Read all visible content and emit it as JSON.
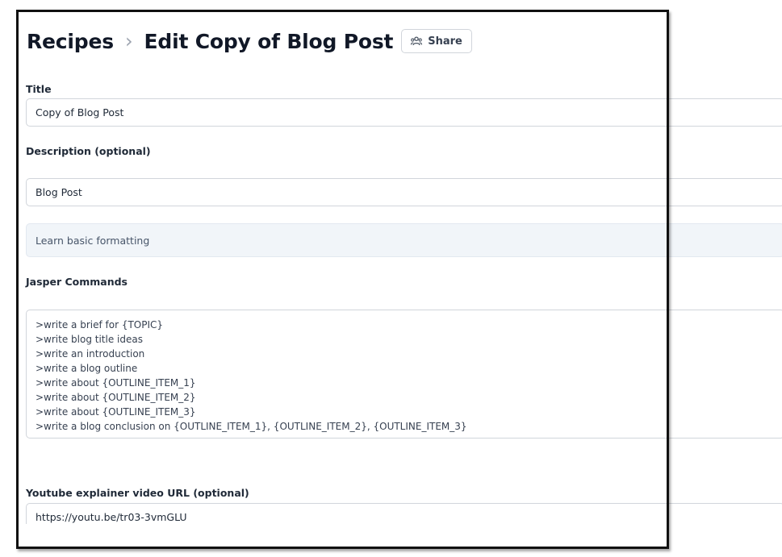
{
  "header": {
    "breadcrumb_root": "Recipes",
    "breadcrumb_separator": "›",
    "page_title": "Edit Copy of Blog Post",
    "share_label": "Share",
    "share_icon": "share-users-icon"
  },
  "form": {
    "title_label": "Title",
    "title_value": "Copy of Blog Post",
    "description_label": "Description (optional)",
    "description_value": "Blog Post",
    "formatting_link": "Learn basic formatting",
    "commands_label": "Jasper Commands",
    "commands": [
      ">write a brief for {TOPIC}",
      ">write blog title ideas",
      ">write an introduction",
      ">write a blog outline",
      ">write about {OUTLINE_ITEM_1}",
      ">write about {OUTLINE_ITEM_2}",
      ">write about {OUTLINE_ITEM_3}",
      ">write a blog conclusion on {OUTLINE_ITEM_1}, {OUTLINE_ITEM_2}, {OUTLINE_ITEM_3}"
    ],
    "video_label": "Youtube explainer video URL (optional)",
    "video_value": "https://youtu.be/tr03-3vmGLU"
  }
}
